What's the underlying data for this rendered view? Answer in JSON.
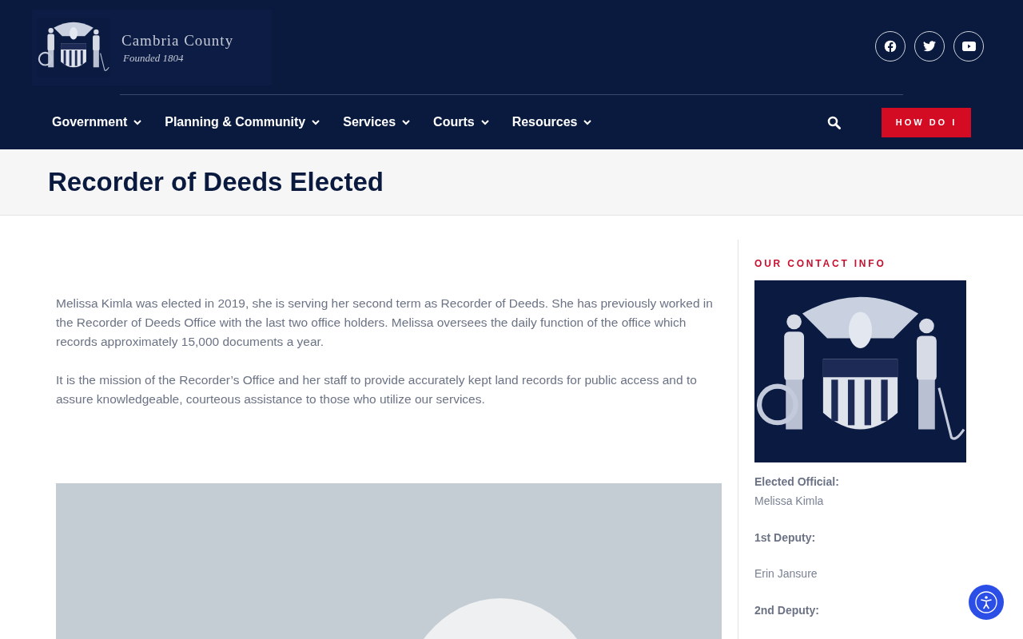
{
  "header": {
    "logo": {
      "title": "Cambria County",
      "subtitle": "Founded 1804"
    },
    "social": [
      {
        "kind": "facebook"
      },
      {
        "kind": "twitter"
      },
      {
        "kind": "youtube"
      }
    ],
    "nav": [
      {
        "label": "Government"
      },
      {
        "label": "Planning & Community"
      },
      {
        "label": "Services"
      },
      {
        "label": "Courts"
      },
      {
        "label": "Resources"
      }
    ],
    "cta": "HOW DO I"
  },
  "page_title": "Recorder of Deeds Elected",
  "content": {
    "paragraphs": [
      "Melissa Kimla was elected in 2019, she is serving her second term as Recorder of Deeds.  She has previously worked in the Recorder of Deeds Office with the last two office holders.  Melissa oversees the daily function of the office which records approximately 15,000 documents a year.",
      "It is the mission of the Recorder’s Office and her staff to provide accurately kept land records for public access and to assure knowledgeable, courteous assistance to those who utilize our services."
    ]
  },
  "sidebar": {
    "heading": "OUR CONTACT INFO",
    "entries": [
      {
        "label": "Elected Official:",
        "value": "Melissa Kimla"
      },
      {
        "label": "1st Deputy:",
        "value": "Erin Jansure"
      },
      {
        "label": "2nd Deputy:"
      }
    ]
  }
}
